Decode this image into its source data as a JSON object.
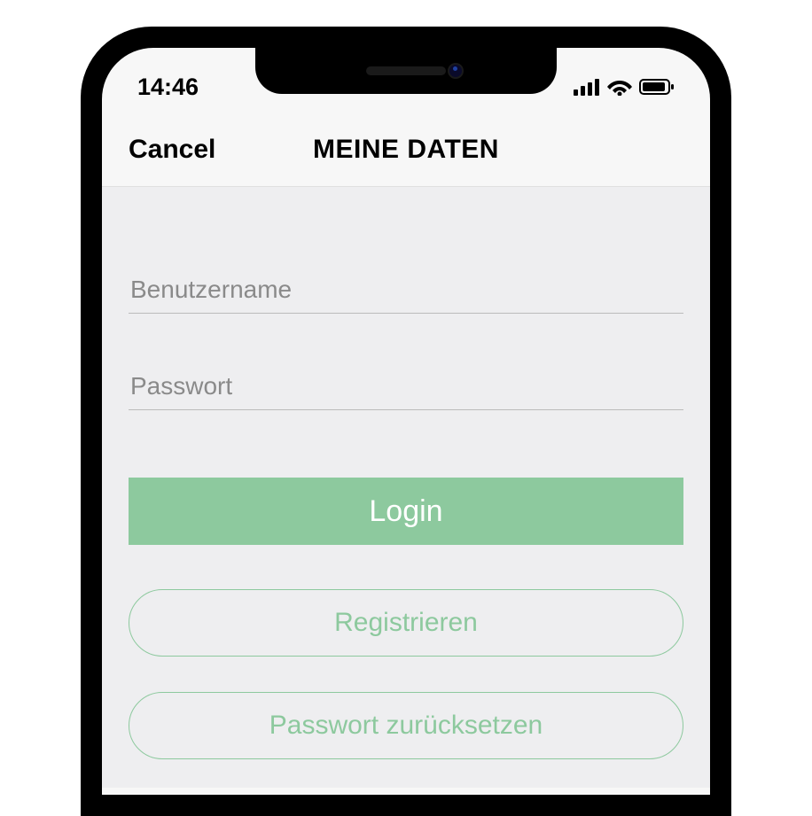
{
  "statusBar": {
    "time": "14:46"
  },
  "navBar": {
    "cancel": "Cancel",
    "title": "MEINE DATEN"
  },
  "form": {
    "usernamePlaceholder": "Benutzername",
    "passwordPlaceholder": "Passwort",
    "loginLabel": "Login",
    "registerLabel": "Registrieren",
    "resetPasswordLabel": "Passwort zurücksetzen"
  }
}
